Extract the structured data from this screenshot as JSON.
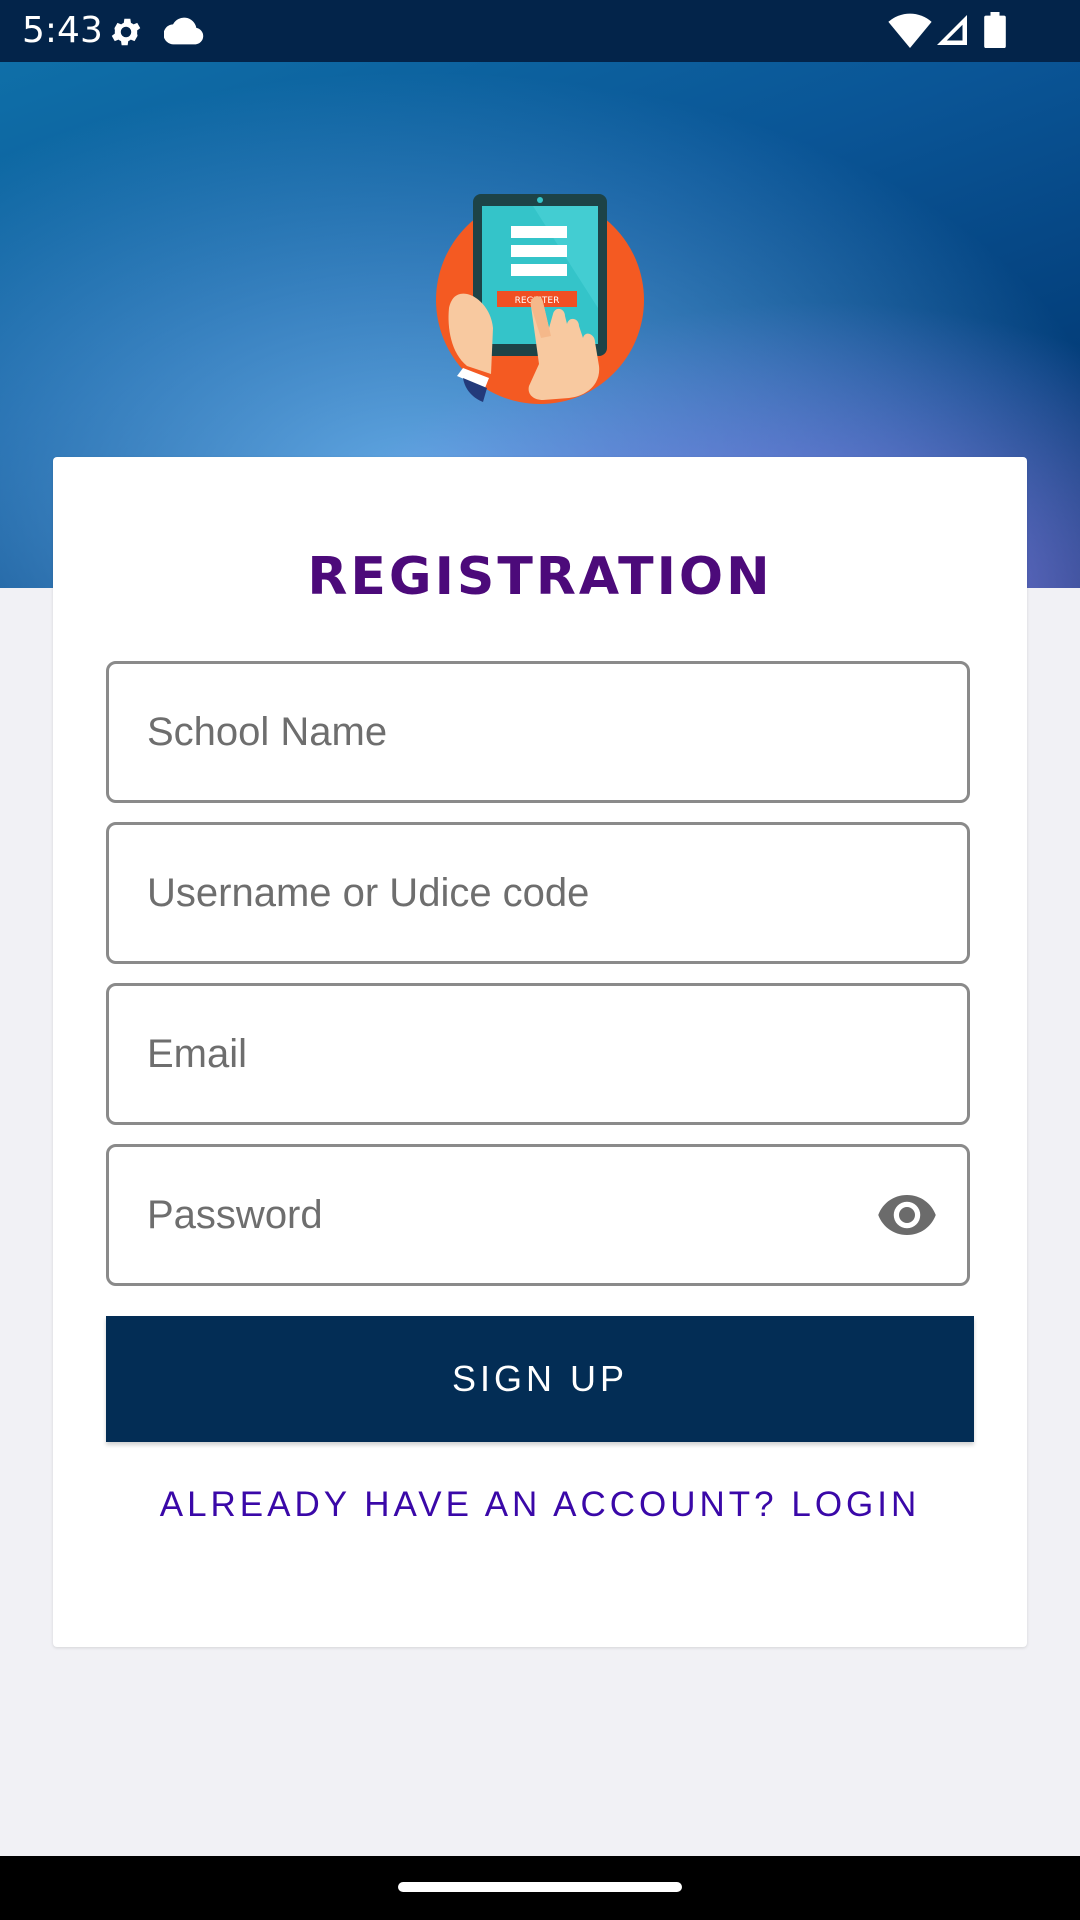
{
  "status_bar": {
    "time": "5:43",
    "icons": [
      "gear-icon",
      "cloud-icon",
      "wifi-icon",
      "signal-icon",
      "battery-icon"
    ]
  },
  "logo": {
    "icon": "register-tablet-icon",
    "text": "REGISTER"
  },
  "form": {
    "title": "Registration",
    "fields": {
      "school_name": {
        "placeholder": "School Name",
        "value": ""
      },
      "username": {
        "placeholder": "Username or Udice code",
        "value": ""
      },
      "email": {
        "placeholder": "Email",
        "value": ""
      },
      "password": {
        "placeholder": "Password",
        "value": "",
        "toggle_icon": "eye-icon"
      }
    },
    "signup_label": "SIGN UP",
    "login_link": "ALREADY HAVE AN ACCOUNT? LOGIN"
  },
  "colors": {
    "status_bar": "#03244a",
    "title": "#4c0a7a",
    "button": "#032d55",
    "link": "#3a08a8",
    "background": "#f1f1f5"
  }
}
